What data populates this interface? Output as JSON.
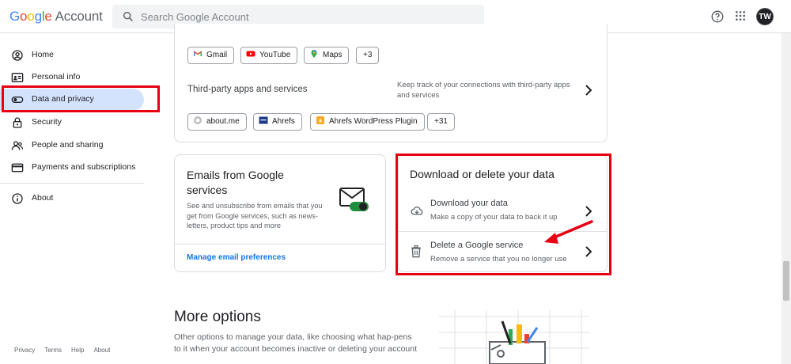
{
  "header": {
    "logo_google": [
      "G",
      "o",
      "o",
      "g",
      "l",
      "e"
    ],
    "logo_account": "Account",
    "search_placeholder": "Search Google Account",
    "avatar_initials": "TW"
  },
  "sidebar": {
    "items": [
      {
        "label": "Home",
        "icon": "home-icon"
      },
      {
        "label": "Personal info",
        "icon": "id-card-icon"
      },
      {
        "label": "Data and privacy",
        "icon": "toggle-icon",
        "active": true
      },
      {
        "label": "Security",
        "icon": "lock-icon"
      },
      {
        "label": "People and sharing",
        "icon": "people-icon"
      },
      {
        "label": "Payments and subscriptions",
        "icon": "credit-card-icon"
      },
      {
        "label": "About",
        "icon": "info-icon"
      }
    ],
    "footer": [
      "Privacy",
      "Terms",
      "Help",
      "About"
    ]
  },
  "apps_card": {
    "chips_top": [
      "Gmail",
      "YouTube",
      "Maps",
      "+3"
    ],
    "third_party_title": "Third-party apps and services",
    "third_party_desc": "Keep track of your connections with third-party apps and services",
    "chips_bottom": [
      "about.me",
      "Ahrefs",
      "Ahrefs WordPress Plugin",
      "+31"
    ]
  },
  "emails_card": {
    "title": "Emails from Google services",
    "desc": "See and unsubscribe from emails that you get from Google services, such as news-letters, product tips and more",
    "link": "Manage email preferences"
  },
  "download_card": {
    "title": "Download or delete your data",
    "rows": [
      {
        "title": "Download your data",
        "desc": "Make a copy of your data to back it up",
        "icon": "cloud-download-icon"
      },
      {
        "title": "Delete a Google service",
        "desc": "Remove a service that you no longer use",
        "icon": "trash-icon"
      }
    ]
  },
  "more_options": {
    "title": "More options",
    "desc": "Other options to manage your data, like choosing what hap-pens to it when your account becomes inactive or deleting your account"
  },
  "colors": {
    "highlight": "#e60012",
    "active_nav": "#d3e3fd",
    "link": "#1a73e8"
  }
}
